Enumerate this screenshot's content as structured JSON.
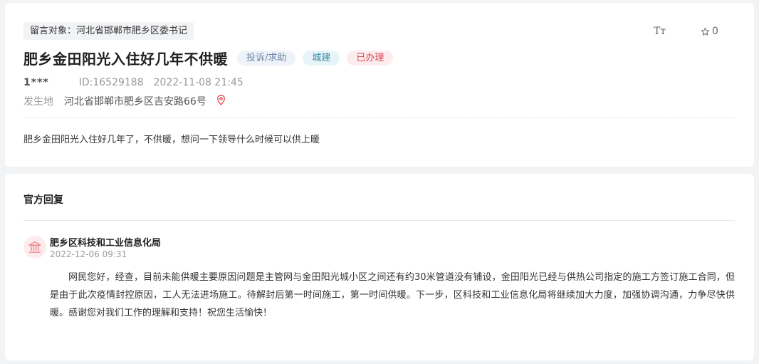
{
  "message": {
    "recipient_label": "留言对象：河北省邯郸市肥乡区委书记",
    "title": "肥乡金田阳光入住好几年不供暖",
    "tags": [
      {
        "label": "投诉/求助",
        "color": "#6f86a8"
      },
      {
        "label": "城建",
        "color": "#3a8ba3"
      },
      {
        "label": "已办理",
        "color": "#d64a55"
      }
    ],
    "font_size_icon_text": "Tт",
    "star_icon": "star-outline-icon",
    "star_count": "0",
    "user": "1***",
    "id": "ID:16529188",
    "datetime": "2022-11-08 21:45",
    "location_label": "发生地",
    "location_address": "河北省邯郸市肥乡区吉安路66号",
    "location_icon": "location-pin-icon",
    "content": "肥乡金田阳光入住好几年了，不供暖，想问一下领导什么时候可以供上暖"
  },
  "reply": {
    "section_title": "官方回复",
    "avatar_icon": "government-building-icon",
    "org_name": "肥乡区科技和工业信息化局",
    "date": "2022-12-06 09:31",
    "text": "网民您好，经查，目前未能供暖主要原因问题是主管网与金田阳光城小区之间还有约30米管道没有铺设，金田阳光已经与供热公司指定的施工方签订施工合同，但是由于此次疫情封控原因，工人无法进场施工。待解封后第一时间施工，第一时间供暖。下一步，区科技和工业信息化局将继续加大力度，加强协调沟通，力争尽快供暖。感谢您对我们工作的理解和支持！祝您生活愉快！"
  },
  "colors": {
    "page_background": "#f2f3f5",
    "tag_red": "#d64a55",
    "pin_red": "#e0474f"
  }
}
